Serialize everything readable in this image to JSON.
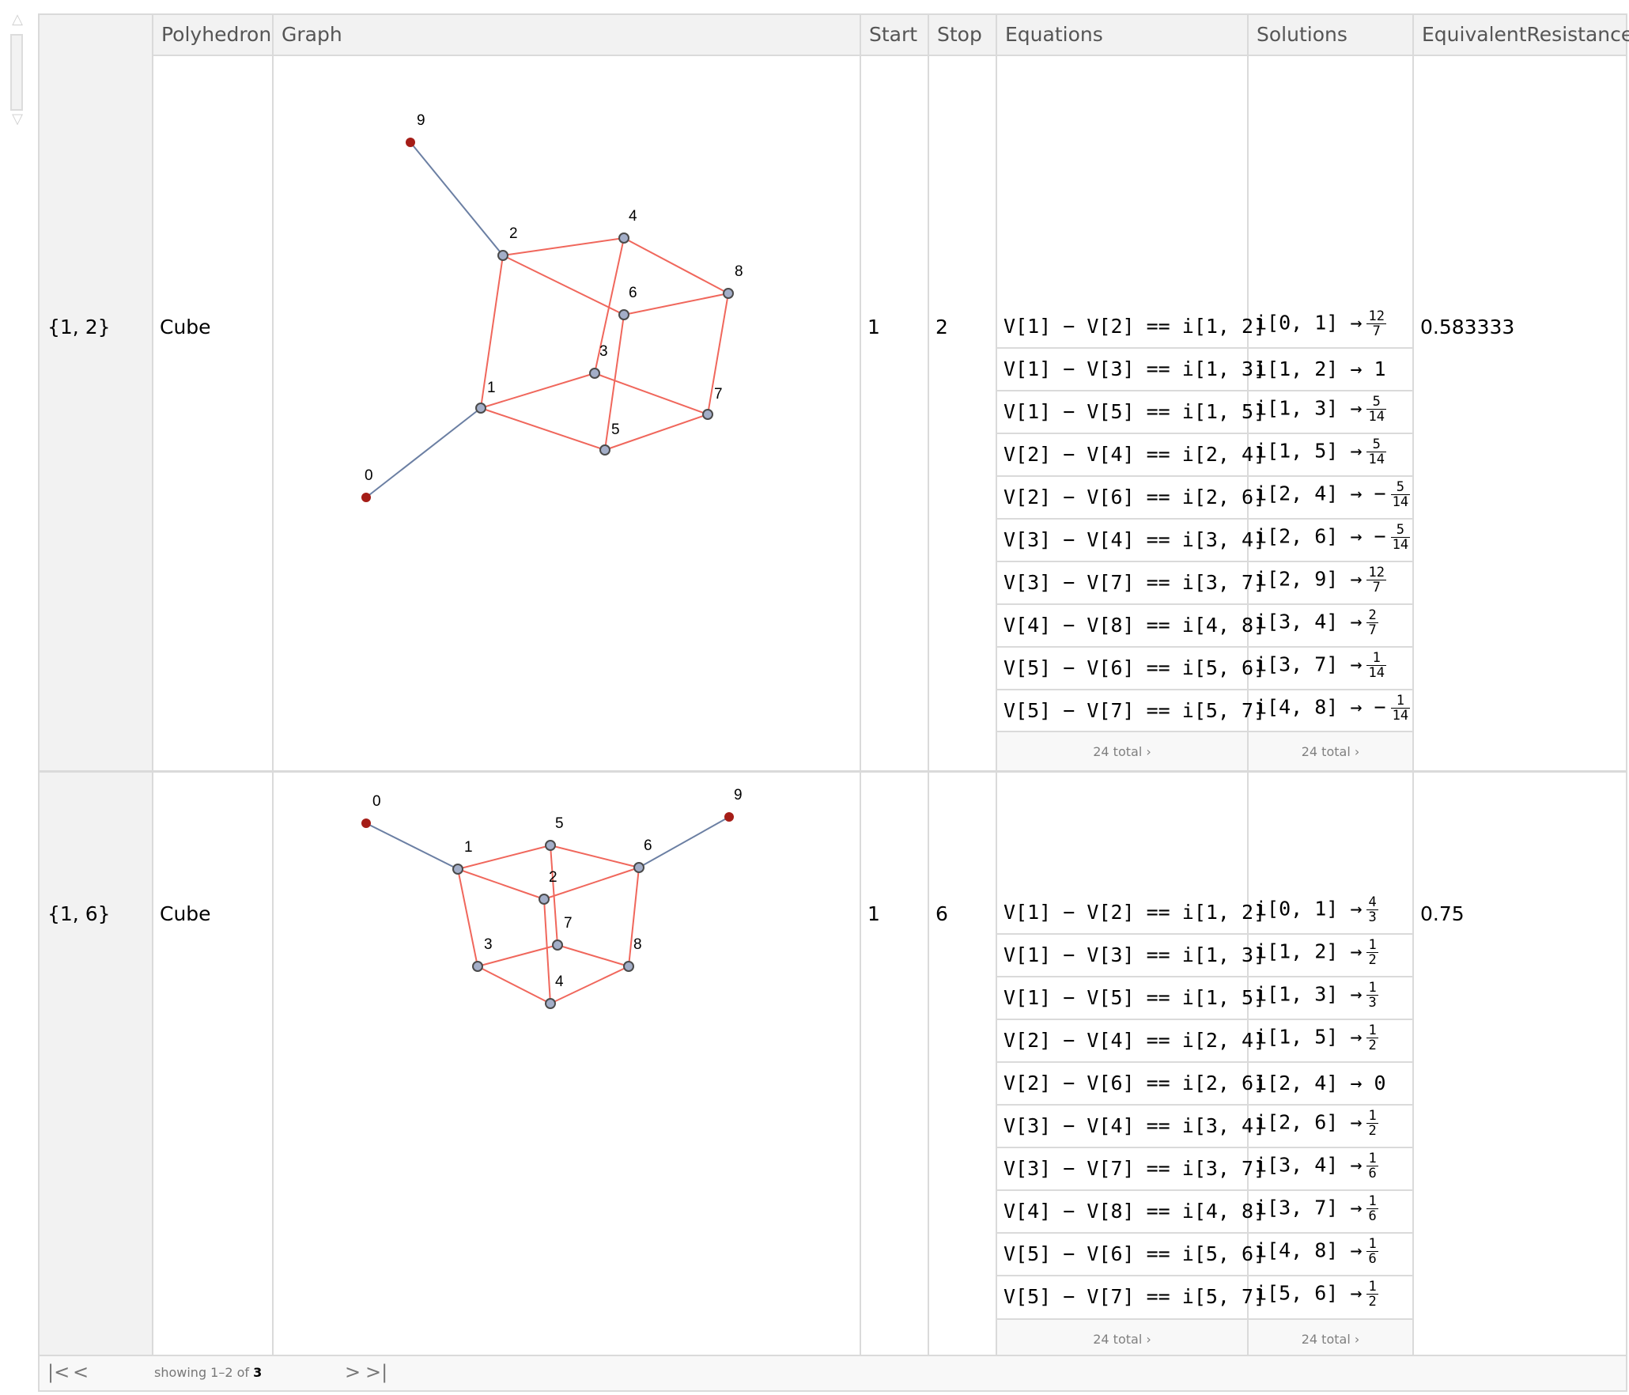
{
  "columns": [
    "",
    "Polyhedron",
    "Graph",
    "Start",
    "Stop",
    "Equations",
    "Solutions",
    "EquivalentResistance"
  ],
  "rows": [
    {
      "key": "{1, 2}",
      "polyhedron": "Cube",
      "start": "1",
      "stop": "2",
      "equivalent_resistance": "0.583333",
      "equations": [
        "V[1] − V[2] == i[1, 2]",
        "V[1] − V[3] == i[1, 3]",
        "V[1] − V[5] == i[1, 5]",
        "V[2] − V[4] == i[2, 4]",
        "V[2] − V[6] == i[2, 6]",
        "V[3] − V[4] == i[3, 4]",
        "V[3] − V[7] == i[3, 7]",
        "V[4] − V[8] == i[4, 8]",
        "V[5] − V[6] == i[5, 6]",
        "V[5] − V[7] == i[5, 7]"
      ],
      "solutions": [
        {
          "lhs": "i[0, 1]",
          "sign": "",
          "num": "12",
          "den": "7"
        },
        {
          "lhs": "i[1, 2]",
          "sign": "",
          "value": "1"
        },
        {
          "lhs": "i[1, 3]",
          "sign": "",
          "num": "5",
          "den": "14"
        },
        {
          "lhs": "i[1, 5]",
          "sign": "",
          "num": "5",
          "den": "14"
        },
        {
          "lhs": "i[2, 4]",
          "sign": "−",
          "num": "5",
          "den": "14"
        },
        {
          "lhs": "i[2, 6]",
          "sign": "−",
          "num": "5",
          "den": "14"
        },
        {
          "lhs": "i[2, 9]",
          "sign": "",
          "num": "12",
          "den": "7"
        },
        {
          "lhs": "i[3, 4]",
          "sign": "",
          "num": "2",
          "den": "7"
        },
        {
          "lhs": "i[3, 7]",
          "sign": "",
          "num": "1",
          "den": "14"
        },
        {
          "lhs": "i[4, 8]",
          "sign": "−",
          "num": "1",
          "den": "14"
        }
      ],
      "equations_total": "24 total ›",
      "solutions_total": "24 total ›",
      "graph": {
        "nodes": [
          {
            "id": "0",
            "terminal": true
          },
          {
            "id": "1"
          },
          {
            "id": "2"
          },
          {
            "id": "3"
          },
          {
            "id": "4"
          },
          {
            "id": "5"
          },
          {
            "id": "6"
          },
          {
            "id": "7"
          },
          {
            "id": "8"
          },
          {
            "id": "9",
            "terminal": true
          }
        ],
        "edges": [
          [
            "9",
            "2",
            "lead"
          ],
          [
            "0",
            "1",
            "lead"
          ],
          [
            "2",
            "4",
            "cube"
          ],
          [
            "2",
            "6",
            "cube"
          ],
          [
            "2",
            "1",
            "cube"
          ],
          [
            "4",
            "8",
            "cube"
          ],
          [
            "4",
            "3",
            "cube"
          ],
          [
            "6",
            "8",
            "cube"
          ],
          [
            "6",
            "5",
            "cube"
          ],
          [
            "8",
            "7",
            "cube"
          ],
          [
            "3",
            "1",
            "cube"
          ],
          [
            "3",
            "7",
            "cube"
          ],
          [
            "1",
            "5",
            "cube"
          ],
          [
            "5",
            "7",
            "cube"
          ]
        ]
      }
    },
    {
      "key": "{1, 6}",
      "polyhedron": "Cube",
      "start": "1",
      "stop": "6",
      "equivalent_resistance": "0.75",
      "equations": [
        "V[1] − V[2] == i[1, 2]",
        "V[1] − V[3] == i[1, 3]",
        "V[1] − V[5] == i[1, 5]",
        "V[2] − V[4] == i[2, 4]",
        "V[2] − V[6] == i[2, 6]",
        "V[3] − V[4] == i[3, 4]",
        "V[3] − V[7] == i[3, 7]",
        "V[4] − V[8] == i[4, 8]",
        "V[5] − V[6] == i[5, 6]",
        "V[5] − V[7] == i[5, 7]"
      ],
      "solutions": [
        {
          "lhs": "i[0, 1]",
          "sign": "",
          "num": "4",
          "den": "3"
        },
        {
          "lhs": "i[1, 2]",
          "sign": "",
          "num": "1",
          "den": "2"
        },
        {
          "lhs": "i[1, 3]",
          "sign": "",
          "num": "1",
          "den": "3"
        },
        {
          "lhs": "i[1, 5]",
          "sign": "",
          "num": "1",
          "den": "2"
        },
        {
          "lhs": "i[2, 4]",
          "sign": "",
          "value": "0"
        },
        {
          "lhs": "i[2, 6]",
          "sign": "",
          "num": "1",
          "den": "2"
        },
        {
          "lhs": "i[3, 4]",
          "sign": "",
          "num": "1",
          "den": "6"
        },
        {
          "lhs": "i[3, 7]",
          "sign": "",
          "num": "1",
          "den": "6"
        },
        {
          "lhs": "i[4, 8]",
          "sign": "",
          "num": "1",
          "den": "6"
        },
        {
          "lhs": "i[5, 6]",
          "sign": "",
          "num": "1",
          "den": "2"
        }
      ],
      "equations_total": "24 total ›",
      "solutions_total": "24 total ›",
      "graph": {
        "nodes": [
          {
            "id": "0",
            "terminal": true
          },
          {
            "id": "1"
          },
          {
            "id": "2"
          },
          {
            "id": "3"
          },
          {
            "id": "4"
          },
          {
            "id": "5"
          },
          {
            "id": "6"
          },
          {
            "id": "7"
          },
          {
            "id": "8"
          },
          {
            "id": "9",
            "terminal": true
          }
        ],
        "edges": [
          [
            "0",
            "1",
            "lead"
          ],
          [
            "6",
            "9",
            "lead"
          ],
          [
            "1",
            "5",
            "cube"
          ],
          [
            "5",
            "6",
            "cube"
          ],
          [
            "1",
            "2",
            "cube"
          ],
          [
            "2",
            "6",
            "cube"
          ],
          [
            "5",
            "7",
            "cube"
          ],
          [
            "2",
            "4",
            "cube"
          ],
          [
            "1",
            "3",
            "cube"
          ],
          [
            "6",
            "8",
            "cube"
          ],
          [
            "3",
            "7",
            "cube"
          ],
          [
            "7",
            "8",
            "cube"
          ],
          [
            "3",
            "4",
            "cube"
          ],
          [
            "4",
            "8",
            "cube"
          ]
        ]
      }
    }
  ],
  "pager": {
    "first_icon": "first-page-icon",
    "prev_icon": "prev-page-icon",
    "next_icon": "next-page-icon",
    "last_icon": "last-page-icon",
    "showing_prefix": "showing 1–2 of ",
    "total": "3"
  },
  "colors": {
    "cube_edge": "#f0675c",
    "lead_edge": "#6b7fa3",
    "node_fill": "#a3aec8",
    "node_stroke": "#4a4a4a",
    "terminal_fill": "#a51d17",
    "header_bg": "#f2f2f2",
    "grid_line": "#dadada"
  }
}
